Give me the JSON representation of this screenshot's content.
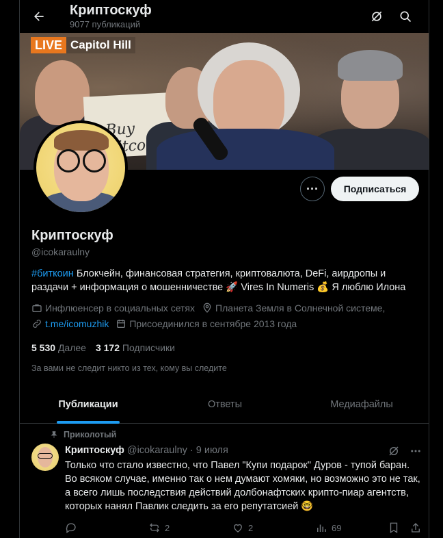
{
  "header": {
    "title": "Криптоскуф",
    "subtitle": "9077 публикаций"
  },
  "banner": {
    "live_label": "LIVE",
    "live_location": "Capitol Hill",
    "sign_text": "Buy Bitcoin"
  },
  "profile": {
    "name": "Криптоскуф",
    "handle": "@icokaraulny",
    "subscribe_label": "Подписаться",
    "more_label": "···",
    "bio_tag": "#биткоин",
    "bio_text": " Блокчейн, финансовая стратегия, криптовалюта, DeFi, аирдропы и раздачи + информация о мошенничестве 🚀 Vires In Numeris 💰 Я люблю Илона",
    "category": "Инфлюенсер в социальных сетях",
    "location": "Планета Земля в Солнечной системе,",
    "link": "t.me/icomuzhik",
    "joined": "Присоединился в сентябре 2013 года",
    "following_count": "5 530",
    "following_label": "Далее",
    "followers_count": "3 172",
    "followers_label": "Подписчики",
    "not_followed_note": "За вами не следит никто из тех, кому вы следите"
  },
  "tabs": [
    {
      "label": "Публикации",
      "active": true
    },
    {
      "label": "Ответы",
      "active": false
    },
    {
      "label": "Медиафайлы",
      "active": false
    }
  ],
  "tweet": {
    "pinned_label": "Приколотый",
    "author": "Криптоскуф",
    "handle": "@icokaraulny",
    "separator": "·",
    "date": "9 июля",
    "text": "Только что стало известно, что Павел \"Купи подарок\" Дуров - тупой баран. Во всяком случае, именно так о нем думают хомяки, но возможно это не так, а всего лишь последствия действий долбонафтских крипто-пиар агентств, которых нанял Павлик следить за его репутатсией 🤓",
    "replies": "",
    "reposts": "2",
    "likes": "2",
    "views": "69"
  },
  "colors": {
    "accent": "#1d9bf0",
    "background": "#000000",
    "muted": "#71767b",
    "text": "#e7e9ea",
    "border": "#2f3336",
    "live_orange": "#e8771e"
  },
  "icons": [
    "back-arrow-icon",
    "grok-icon",
    "search-icon",
    "more-icon",
    "briefcase-icon",
    "location-icon",
    "link-icon",
    "calendar-icon",
    "pin-icon",
    "reply-icon",
    "repost-icon",
    "like-icon",
    "views-icon",
    "bookmark-icon",
    "share-icon"
  ]
}
